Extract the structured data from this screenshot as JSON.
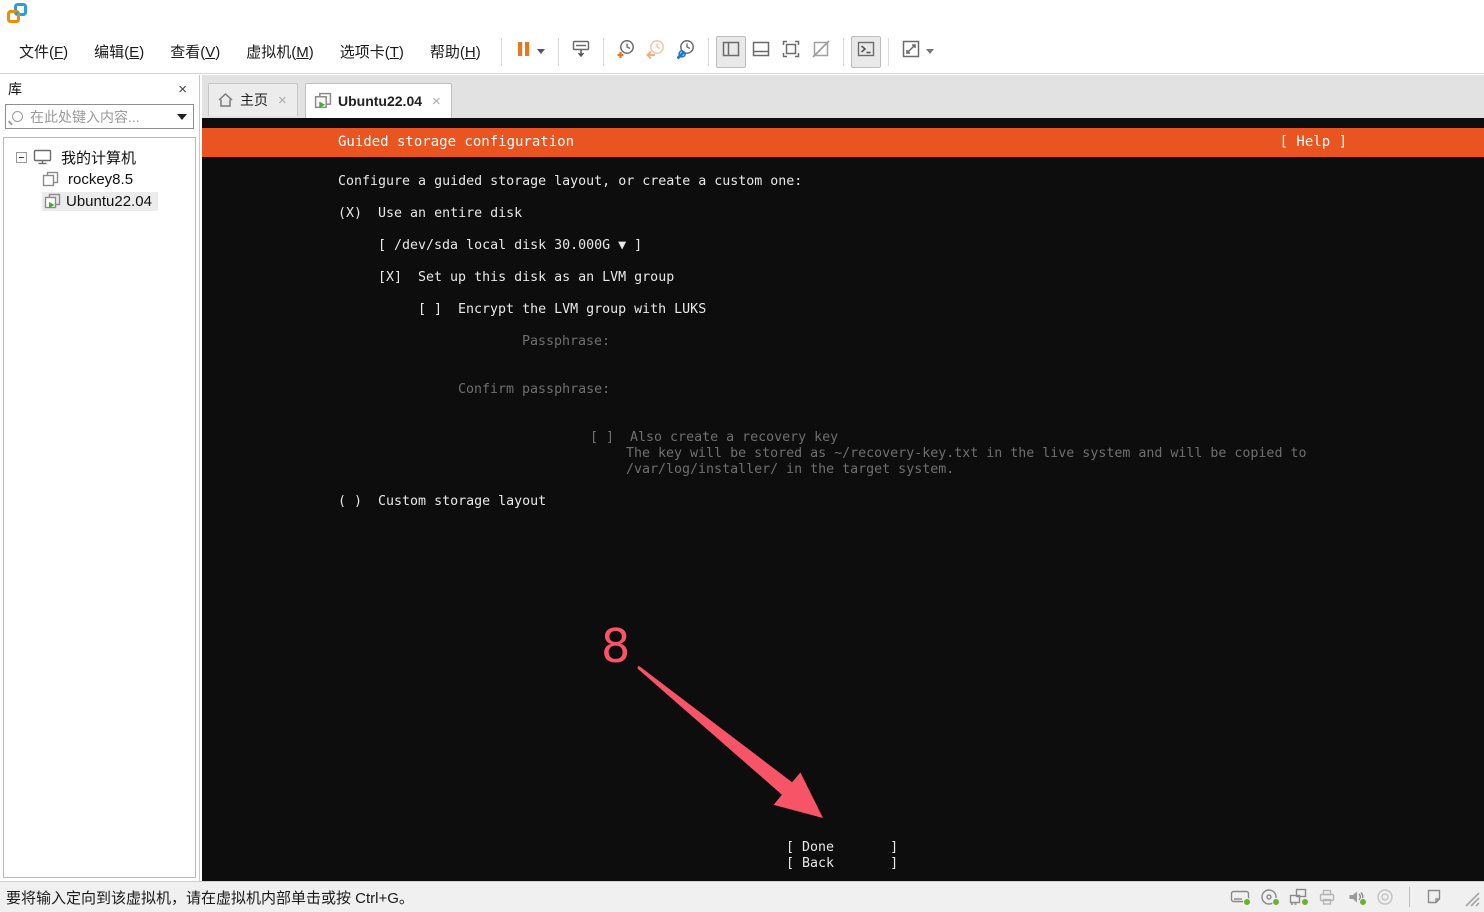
{
  "titlebar": {
    "logo": "vmware-workstation-logo"
  },
  "menubar": {
    "items": [
      {
        "pre": "文件(",
        "key": "F",
        "post": ")"
      },
      {
        "pre": "编辑(",
        "key": "E",
        "post": ")"
      },
      {
        "pre": "查看(",
        "key": "V",
        "post": ")"
      },
      {
        "pre": "虚拟机(",
        "key": "M",
        "post": ")"
      },
      {
        "pre": "选项卡(",
        "key": "T",
        "post": ")"
      },
      {
        "pre": "帮助(",
        "key": "H",
        "post": ")"
      }
    ]
  },
  "toolbar": {
    "icons": [
      "pause",
      "send-ctrl-alt-del",
      "take-snapshot",
      "revert-snapshot",
      "manage-snapshots",
      "toggle-library-panel",
      "toggle-thumbnail-bar",
      "enter-fullscreen",
      "unity-mode",
      "toggle-console-view",
      "stretch-guest-display"
    ]
  },
  "glyphs": {
    "close": "×",
    "tab_close": "×"
  },
  "sidebar": {
    "title": "库",
    "search_placeholder": "在此处键入内容...",
    "tree": {
      "root": "我的计算机",
      "children": [
        {
          "label": "rockey8.5"
        },
        {
          "label": "Ubuntu22.04"
        }
      ]
    }
  },
  "tabs": [
    {
      "label": "主页"
    },
    {
      "label": "Ubuntu22.04"
    }
  ],
  "installer": {
    "title": "Guided storage configuration",
    "help_label": "[ Help ]",
    "lines": [
      {
        "text": "Configure a guided storage layout, or create a custom one:"
      },
      {
        "text": "(X)  Use an entire disk"
      },
      {
        "text": "[ /dev/sda local disk 30.000G ▼ ]"
      },
      {
        "text": "[X]  Set up this disk as an LVM group"
      },
      {
        "text": "[ ]  Encrypt the LVM group with LUKS"
      },
      {
        "text": "Passphrase:"
      },
      {
        "text": "Confirm passphrase:"
      },
      {
        "text": "[ ]  Also create a recovery key"
      },
      {
        "text": "The key will be stored as ~/recovery-key.txt in the live system and will be copied to"
      },
      {
        "text": "/var/log/installer/ in the target system."
      },
      {
        "text": "( )  Custom storage layout"
      }
    ],
    "done_label": "[ Done       ]",
    "back_label": "[ Back       ]",
    "annotation_number": "8"
  },
  "statusbar": {
    "message": "要将输入定向到该虚拟机，请在虚拟机内部单击或按 Ctrl+G。",
    "device_icons": [
      "hard-disk",
      "cd-drive",
      "network-adapter",
      "printer",
      "sound",
      "webcam",
      "message",
      "resize-grip"
    ]
  },
  "colors": {
    "ubuntu_orange": "#E95420",
    "annotation_pink": "#F85468",
    "status_green": "#67B32E",
    "pause_orange": "#E87722",
    "snapshot_blue": "#1E78C8"
  }
}
